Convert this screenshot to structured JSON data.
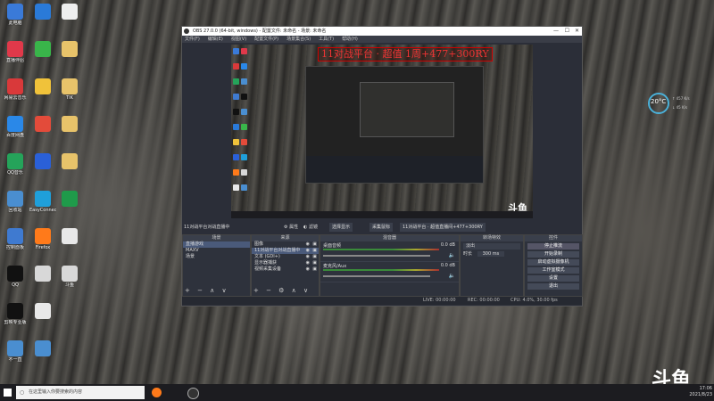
{
  "desktop": {
    "icons_col1": [
      "此电脑",
      "直播伴侣",
      "网易云音乐",
      "百度网盘",
      "QQ音乐",
      "回收站",
      "控制面板",
      "QQ",
      "剪映专业版",
      "不一直"
    ],
    "icons_col2": [
      "",
      "",
      "",
      "",
      "",
      "EasyConnect",
      "Firefox",
      "",
      "",
      ""
    ],
    "icons_col3": [
      "",
      "",
      "TIK",
      "",
      "",
      "",
      "",
      "斗鱼"
    ],
    "col1_colors": [
      "#3a7ad8",
      "#e0394a",
      "#d9393a",
      "#2a88e8",
      "#25a35a",
      "#4a8ed0",
      "#3f7ad0",
      "#111",
      "#111",
      "#4a8ed0"
    ],
    "col2_colors": [
      "#2a7ad8",
      "#39b54a",
      "#f0c23a",
      "#e34b3a",
      "#2a60d8",
      "#1f9fda",
      "#ff7a1a",
      "#d8d8d8",
      "#e8e8e8",
      "#4a8ed0"
    ],
    "col3_colors": [
      "#eee",
      "#e8c36a",
      "#e8c36a",
      "#e8c36a",
      "#e8c36a",
      "#1f9a4a",
      "#e8e8e8",
      "#d8d8d8"
    ]
  },
  "obs": {
    "title": "OBS 27.0.0 (64-bit, windows) - 配置文件: 未命名 - 场景: 未命名",
    "menu": [
      "文件(F)",
      "编辑(E)",
      "视图(V)",
      "配置文件(P)",
      "场景集合(S)",
      "工具(T)",
      "帮助(H)"
    ],
    "banner_text": "11对战平台 · 超值 1周+477+300RY",
    "control_bar": {
      "label": "11对战平台对战直播中",
      "props": "属性",
      "filters": "滤镜",
      "combo": "选择显示",
      "capture": "采集鼠标",
      "source_label": "11对战平台 · 超值直播间+477+300RY"
    },
    "scenes": {
      "header": "场景",
      "items": [
        "直播游戏",
        "MAXV",
        "场景"
      ]
    },
    "sources": {
      "header": "来源",
      "items": [
        "图像",
        "11对战平台对战直播中",
        "文本 (GDI+)",
        "显示器捕获",
        "视频采集设备"
      ]
    },
    "mixer": {
      "header": "混音器",
      "channels": [
        "桌面音频",
        "麦克风/Aux"
      ],
      "db": "0.0 dB"
    },
    "transitions": {
      "header": "转场特效",
      "type": "淡出",
      "duration_label": "时长",
      "duration": "300 ms"
    },
    "controls": {
      "header": "控件",
      "buttons": [
        "停止推流",
        "开始录制",
        "启动虚拟摄像机",
        "工作室模式",
        "设置",
        "退出"
      ]
    },
    "status": {
      "live": "LIVE: 00:00:00",
      "rec": "REC: 00:00:00",
      "cpu": "CPU: 4.0%, 30.00 fps"
    }
  },
  "taskbar": {
    "search_placeholder": "在这里输入你要搜索的内容",
    "time": "17:06",
    "date": "2021/8/23"
  },
  "widget": {
    "temp": "20°C",
    "up": "↑ 457 K/s",
    "down": "↓ 45 K/s"
  },
  "watermark": "斗鱼"
}
